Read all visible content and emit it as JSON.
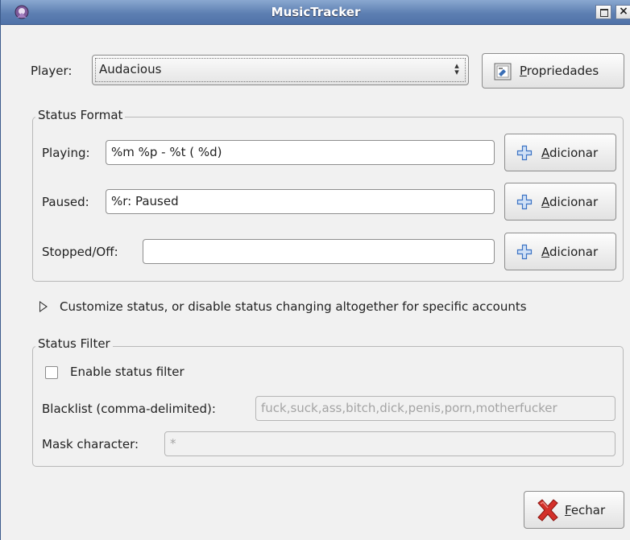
{
  "window": {
    "title": "MusicTracker",
    "close_glyph": "×"
  },
  "player": {
    "label": "Player:",
    "selected": "Audacious",
    "properties_underlined": "P",
    "properties_rest": "ropriedades"
  },
  "status_format": {
    "title": "Status Format",
    "rows": [
      {
        "label": "Playing:",
        "value": "%m  %p - %t ( %d)"
      },
      {
        "label": "Paused:",
        "value": "%r: Paused"
      },
      {
        "label": "Stopped/Off:",
        "value": ""
      }
    ],
    "add_underlined": "A",
    "add_rest": "dicionar"
  },
  "customize": {
    "label": "Customize status, or disable status changing altogether for specific accounts"
  },
  "status_filter": {
    "title": "Status Filter",
    "enable_label": "Enable status filter",
    "enable_checked": false,
    "blacklist_label": "Blacklist (comma-delimited):",
    "blacklist_value": "fuck,suck,ass,bitch,dick,penis,porn,motherfucker",
    "mask_label": "Mask character:",
    "mask_value": "*"
  },
  "footer": {
    "close_underlined": "F",
    "close_rest": "echar"
  },
  "icons": {
    "app": "app-icon",
    "maximize": "maximize-icon",
    "close": "close-icon",
    "properties": "properties-icon",
    "add": "add-icon",
    "expander": "expander-arrow-icon",
    "fechar": "close-x-icon"
  },
  "colors": {
    "accent": "#5d7fb2",
    "add_icon": "#5b8fd6",
    "close_icon": "#d3302a"
  }
}
